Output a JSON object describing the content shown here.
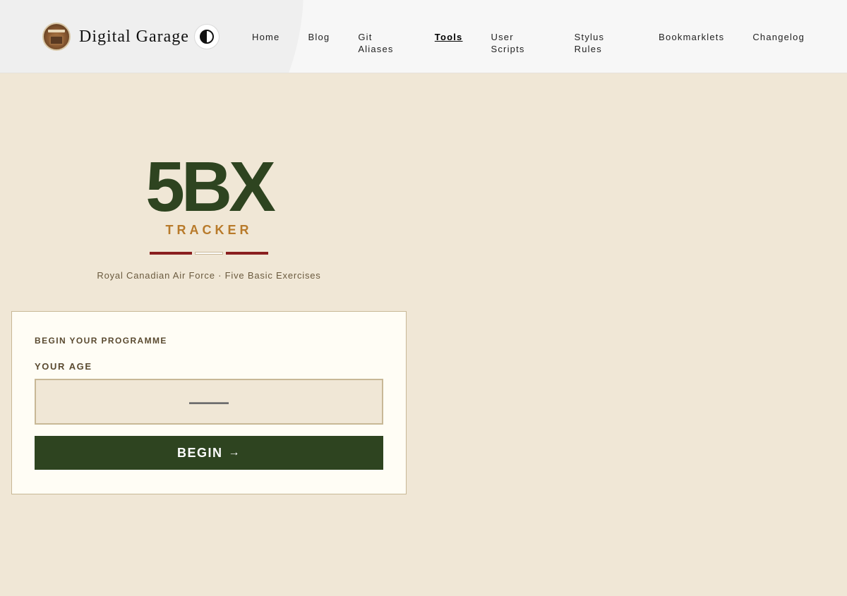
{
  "brand": {
    "name": "Digital Garage"
  },
  "nav": {
    "items": [
      {
        "label": "Home"
      },
      {
        "label": "Blog"
      },
      {
        "label": "Git Aliases"
      },
      {
        "label": "Tools",
        "active": true
      },
      {
        "label": "User Scripts"
      },
      {
        "label": "Stylus Rules"
      },
      {
        "label": "Bookmarklets"
      },
      {
        "label": "Changelog"
      }
    ]
  },
  "hero": {
    "title": "5BX",
    "subtitle": "TRACKER",
    "tagline": "Royal Canadian Air Force · Five Basic Exercises"
  },
  "card": {
    "heading": "BEGIN YOUR PROGRAMME",
    "age_label": "YOUR AGE",
    "age_placeholder": "——",
    "age_value": "",
    "begin_label": "BEGIN",
    "begin_arrow": "→"
  },
  "colors": {
    "page_bg": "#f0e7d6",
    "primary_green": "#2e4420",
    "accent_amber": "#b87a2a",
    "accent_red": "#8a1f1f"
  },
  "icons": {
    "logo": "garage-logo-icon",
    "theme_toggle": "half-circle-contrast-icon",
    "begin_arrow": "arrow-right-icon"
  }
}
